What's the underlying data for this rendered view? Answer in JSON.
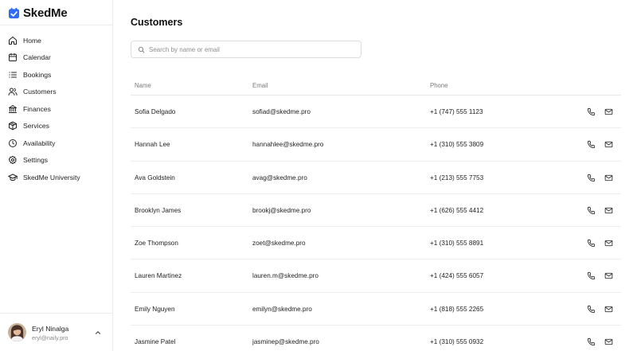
{
  "app": {
    "logo_text": "SkedMe",
    "brand_color": "#2f6df6"
  },
  "sidebar": {
    "items": [
      {
        "label": "Home",
        "icon": "home-icon"
      },
      {
        "label": "Calendar",
        "icon": "calendar-icon"
      },
      {
        "label": "Bookings",
        "icon": "list-icon"
      },
      {
        "label": "Customers",
        "icon": "users-icon"
      },
      {
        "label": "Finances",
        "icon": "bank-icon"
      },
      {
        "label": "Services",
        "icon": "box-icon"
      },
      {
        "label": "Availability",
        "icon": "clock-icon"
      },
      {
        "label": "Settings",
        "icon": "gear-icon"
      },
      {
        "label": "SkedMe University",
        "icon": "graduation-cap-icon"
      }
    ],
    "user": {
      "name": "Eryl Ninalga",
      "email": "eryl@naily.pro"
    }
  },
  "main": {
    "title": "Customers",
    "search": {
      "placeholder": "Search by name or email",
      "value": ""
    },
    "table": {
      "headers": {
        "name": "Name",
        "email": "Email",
        "phone": "Phone"
      },
      "rows": [
        {
          "name": "Sofia Delgado",
          "email": "sofiad@skedme.pro",
          "phone": "+1 (747) 555 1123"
        },
        {
          "name": "Hannah Lee",
          "email": "hannahlee@skedme.pro",
          "phone": "+1 (310) 555 3809"
        },
        {
          "name": "Ava Goldstein",
          "email": "avag@skedme.pro",
          "phone": "+1 (213) 555 7753"
        },
        {
          "name": "Brooklyn James",
          "email": "brookj@skedme.pro",
          "phone": "+1 (626) 555 4412"
        },
        {
          "name": "Zoe Thompson",
          "email": "zoet@skedme.pro",
          "phone": "+1 (310) 555 8891"
        },
        {
          "name": "Lauren Martinez",
          "email": "lauren.m@skedme.pro",
          "phone": "+1 (424) 555 6057"
        },
        {
          "name": "Emily Nguyen",
          "email": "emilyn@skedme.pro",
          "phone": "+1 (818) 555 2265"
        },
        {
          "name": "Jasmine Patel",
          "email": "jasminep@skedme.pro",
          "phone": "+1 (310) 555 0932"
        }
      ],
      "row_actions": [
        "phone-icon",
        "mail-icon"
      ]
    }
  }
}
